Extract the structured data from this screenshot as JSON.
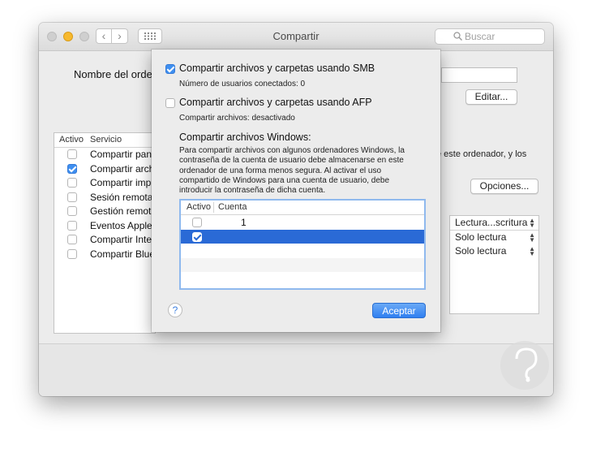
{
  "window": {
    "title": "Compartir"
  },
  "toolbar": {
    "search_placeholder": "Buscar"
  },
  "main": {
    "computer_name_label": "Nombre del ordena",
    "edit_button": "Editar...",
    "description_right": "e este ordenador, y los",
    "options_button": "Opciones...",
    "services_table": {
      "headers": [
        "Activo",
        "Servicio"
      ],
      "rows": [
        {
          "checked": false,
          "label": "Compartir panta"
        },
        {
          "checked": true,
          "label": "Compartir archi"
        },
        {
          "checked": false,
          "label": "Compartir impre"
        },
        {
          "checked": false,
          "label": "Sesión remota"
        },
        {
          "checked": false,
          "label": "Gestión remota"
        },
        {
          "checked": false,
          "label": "Eventos Apple r"
        },
        {
          "checked": false,
          "label": "Compartir Intern"
        },
        {
          "checked": false,
          "label": "Compartir Bluet"
        }
      ]
    },
    "permissions_table": {
      "header": "Lectura...scritura",
      "rows": [
        "Solo lectura",
        "Solo lectura"
      ]
    }
  },
  "sheet": {
    "smb_label": "Compartir archivos y carpetas usando SMB",
    "smb_checked": true,
    "smb_status": "Número de usuarios conectados: 0",
    "afp_label": "Compartir archivos y carpetas usando AFP",
    "afp_checked": false,
    "afp_status": "Compartir archivos: desactivado",
    "windows_title": "Compartir archivos Windows:",
    "windows_description": "Para compartir archivos con algunos ordenadores Windows, la contraseña de la cuenta de usuario debe almacenarse en este ordenador de una forma menos segura. Al activar el uso compartido de Windows para una cuenta de usuario, debe introducir la contraseña de dicha cuenta.",
    "accounts_table": {
      "headers": [
        "Activo",
        "Cuenta"
      ],
      "rows": [
        {
          "checked": false,
          "name": "1",
          "selected": false
        },
        {
          "checked": true,
          "name": "",
          "selected": true
        }
      ]
    },
    "help_label": "?",
    "accept_button": "Aceptar"
  },
  "colors": {
    "accent": "#2f7ff0",
    "selection": "#2a6ad6"
  },
  "icons": [
    "back-icon",
    "forward-icon",
    "grid-icon",
    "search-icon",
    "help-icon",
    "checkbox-icon"
  ]
}
